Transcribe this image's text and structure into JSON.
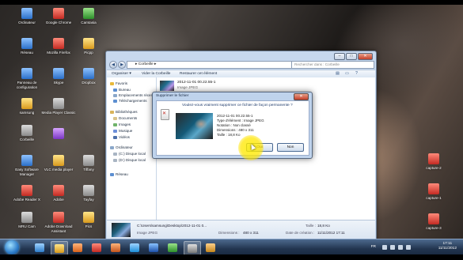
{
  "desktop": {
    "icons_left": [
      {
        "label": "Ordinateur",
        "icon": "computer-icon",
        "color": "blue"
      },
      {
        "label": "Réseau",
        "icon": "network-icon",
        "color": "blue"
      },
      {
        "label": "Panneau de configuration",
        "icon": "control-panel-icon",
        "color": "blue"
      },
      {
        "label": "samsung",
        "icon": "user-folder-icon",
        "color": "yellow"
      },
      {
        "label": "Corbeille",
        "icon": "recycle-bin-icon",
        "color": "grey"
      },
      {
        "label": "Easy Software Manager",
        "icon": "software-manager-icon",
        "color": "blue"
      },
      {
        "label": "Adobe Reader X",
        "icon": "adobe-reader-icon",
        "color": "red"
      },
      {
        "label": "MRU Cam",
        "icon": "camera-icon",
        "color": "grey"
      }
    ],
    "icons_col2": [
      {
        "label": "Google Chrome",
        "icon": "chrome-icon",
        "color": "red"
      },
      {
        "label": "Mozilla Firefox",
        "icon": "firefox-icon",
        "color": "red"
      },
      {
        "label": "Skype",
        "icon": "skype-icon",
        "color": "blue"
      },
      {
        "label": "Media Player Classic",
        "icon": "media-player-icon",
        "color": "grey"
      },
      {
        "label": "",
        "icon": "shortcut-icon",
        "color": "purple"
      },
      {
        "label": "VLC media player",
        "icon": "vlc-icon",
        "color": "yellow"
      },
      {
        "label": "Adobe",
        "icon": "adobe-icon",
        "color": "red"
      },
      {
        "label": "Adobe Download Assistant",
        "icon": "adobe-download-icon",
        "color": "red"
      }
    ],
    "icons_col3": [
      {
        "label": "Camtasia",
        "icon": "camtasia-icon",
        "color": "green"
      },
      {
        "label": "Picpp",
        "icon": "picpp-icon",
        "color": "yellow"
      },
      {
        "label": "Dropbox",
        "icon": "dropbox-icon",
        "color": "blue"
      },
      {
        "label": "Tiffany",
        "icon": "image-file-icon",
        "color": "grey"
      },
      {
        "label": "Tayfay",
        "icon": "image-file-icon",
        "color": "grey"
      },
      {
        "label": "Pics",
        "icon": "folder-icon",
        "color": "yellow"
      }
    ],
    "icons_right": [
      {
        "label": "capture-2",
        "icon": "capture-file-icon",
        "color": "red"
      },
      {
        "label": "capture-1",
        "icon": "capture-file-icon",
        "color": "red"
      },
      {
        "label": "capture-3",
        "icon": "capture-file-icon",
        "color": "red"
      }
    ]
  },
  "explorer": {
    "address": "▸ Corbeille ▸",
    "search_placeholder": "Rechercher dans : Corbeille",
    "commands": {
      "organize": "Organiser ▾",
      "empty": "Vider la Corbeille",
      "restore": "Restaurer cet élément"
    },
    "nav": {
      "favorites": "Favoris",
      "items": [
        "Bureau",
        "Emplacements récents",
        "Téléchargements"
      ],
      "libraries": "Bibliothèques",
      "library_items": [
        "Documents",
        "Images",
        "Musique",
        "Vidéos"
      ],
      "computer": "Ordinateur",
      "computer_items": [
        "(C:) Disque local",
        "(D:) Disque local"
      ],
      "network": "Réseau"
    },
    "file": {
      "name": "2012-11-01 00.22.55-1",
      "type": "Image JPEG"
    },
    "details": {
      "path": "C:\\Users\\samsung\\Desktop\\2012-11-01 0...",
      "type": "Image JPEG",
      "dimensions_label": "Dimensions :",
      "dimensions": "480 x 311",
      "size_label": "Taille :",
      "size": "18,8 Ko",
      "date_label": "Date de création :",
      "date": "11/11/2012 17:11"
    }
  },
  "dialog": {
    "title": "Supprimer le fichier",
    "close": "✕",
    "question": "Voulez-vous vraiment supprimer ce fichier de façon permanente ?",
    "info": [
      "2012-11-01 00.22.55-1",
      "Type d'élément : Image JPEG",
      "Notation : Non classé",
      "Dimensions : 480 x 311",
      "Taille : 18,8 Ko"
    ],
    "yes": "Oui",
    "no": "Non"
  },
  "taskbar": {
    "language": "FR",
    "time": "17:11",
    "date": "11/11/2012"
  },
  "colors": {
    "accent": "#2d7cc9",
    "highlight": "#ffe600",
    "close": "#c4402a"
  }
}
